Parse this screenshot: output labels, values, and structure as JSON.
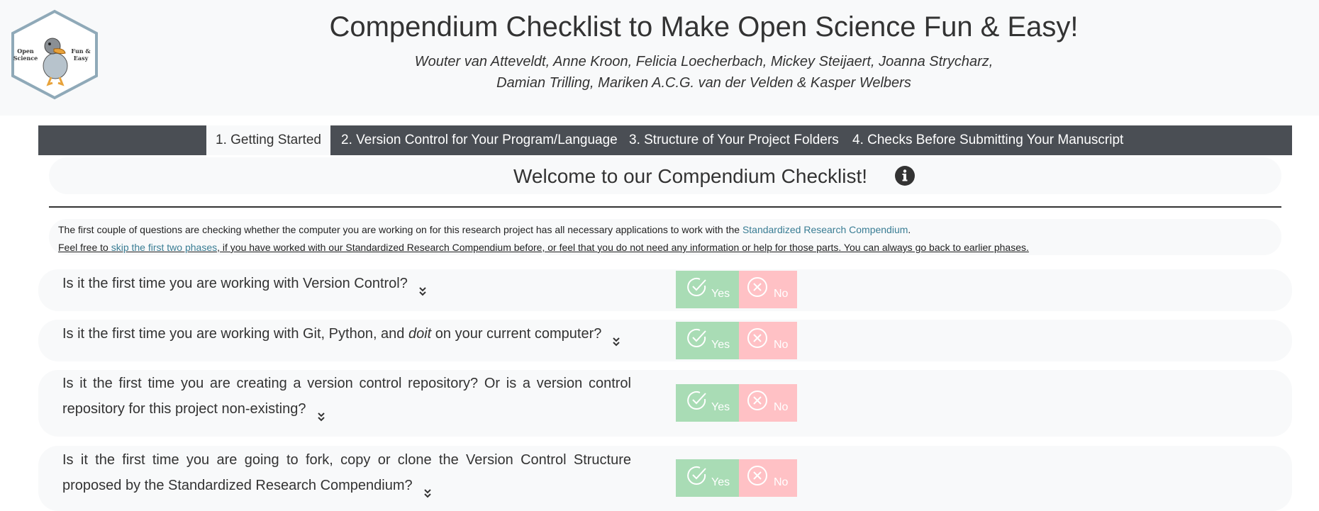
{
  "header": {
    "logo": {
      "left_text": "Open\nScience",
      "right_text": "Fun &\nEasy",
      "icon": "dodo-mascot-icon"
    },
    "title": "Compendium Checklist to Make Open Science Fun & Easy!",
    "authors_line1": "Wouter van Atteveldt, Anne Kroon, Felicia Loecherbach, Mickey Steijaert, Joanna Strycharz,",
    "authors_line2": "Damian Trilling, Mariken A.C.G. van der Velden & Kasper Welbers"
  },
  "tabs": [
    {
      "label": "1. Getting Started",
      "active": true
    },
    {
      "label": "2. Version Control for Your Program/Language",
      "active": false
    },
    {
      "label": "3. Structure of Your Project Folders",
      "active": false
    },
    {
      "label": "4. Checks Before Submitting Your Manuscript",
      "active": false
    }
  ],
  "welcome": {
    "title": "Welcome to our Compendium Checklist!",
    "icon": "info-icon"
  },
  "intro": {
    "line1_prefix": "The first couple of questions are checking whether the computer you are working on for this research project has all necessary applications to work with the ",
    "line1_link": "Standardized Research Compendium",
    "line1_suffix": ".",
    "line2_prefix": "Feel free to ",
    "line2_link": "skip the first two phases",
    "line2_suffix": ", if you have worked with our Standardized Research Compendium before, or feel that you do not need any information or help for those parts. You can always go back to earlier phases."
  },
  "questions": [
    {
      "text_a": "Is it the first time you are working with Version Control?",
      "italic": "",
      "text_b": ""
    },
    {
      "text_a": "Is it the first time you are working with Git, Python, and ",
      "italic": "doit",
      "text_b": " on your current computer?"
    },
    {
      "text_a": "Is it the first time you are creating a version control repository? Or is a version control repository for this project non-existing?",
      "italic": "",
      "text_b": ""
    },
    {
      "text_a": "Is it the first time you are going to fork, copy or clone the Version Control Structure proposed by the Standardized Research Compendium?",
      "italic": "",
      "text_b": ""
    }
  ],
  "buttons": {
    "yes_label": "Yes",
    "no_label": "No"
  },
  "colors": {
    "tabbar": "#4a4e54",
    "panel": "#f8f9fa",
    "yes": "#a9dcb5",
    "no": "#ffc1c5",
    "link": "#3a7d94",
    "logo_border": "#8fa9b8"
  }
}
